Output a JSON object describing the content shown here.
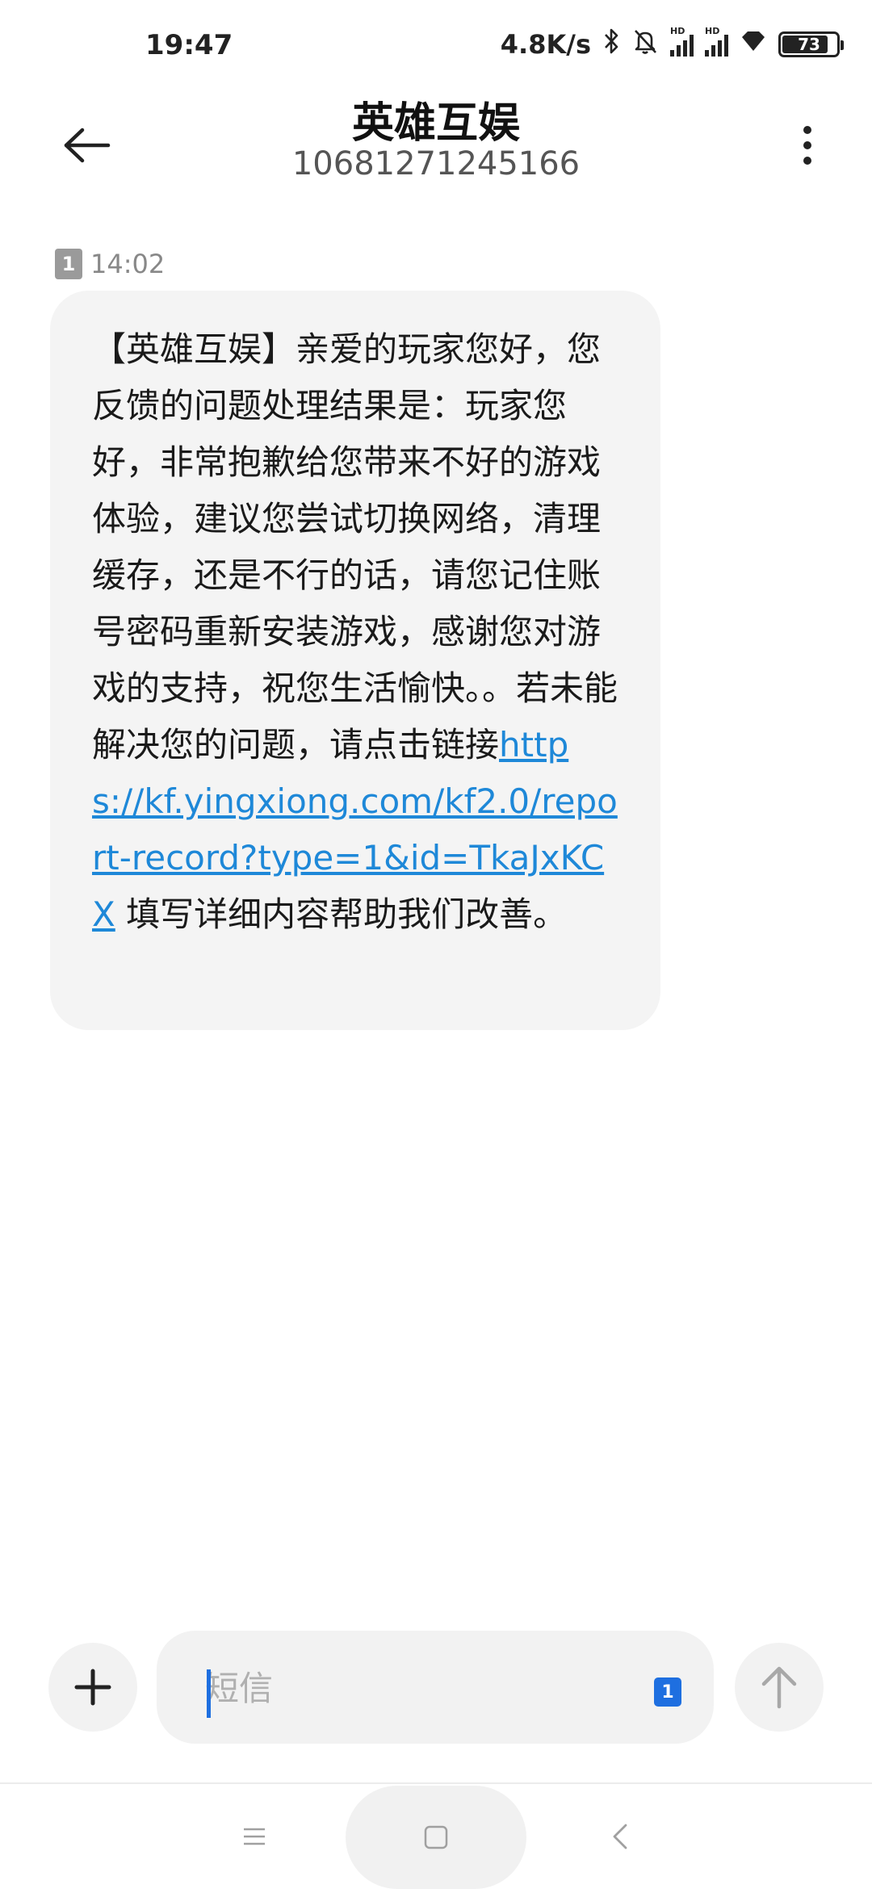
{
  "status_bar": {
    "time": "19:47",
    "net_speed": "4.8K/s",
    "sim1_tag": "HD",
    "sim2_tag": "HD",
    "battery": "73",
    "icons": [
      "bluetooth-icon",
      "mute-bell-icon",
      "signal-icon",
      "signal-icon",
      "diamond-icon",
      "battery-icon"
    ]
  },
  "header": {
    "contact_name": "英雄互娱",
    "contact_number": "10681271245166"
  },
  "message": {
    "sim_slot": "1",
    "time": "14:02",
    "text_before_link": "【英雄互娱】亲爱的玩家您好，您反馈的问题处理结果是：玩家您好，非常抱歉给您带来不好的游戏体验，建议您尝试切换网络，清理缓存，还是不行的话，请您记住账号密码重新安装游戏，感谢您对游戏的支持，祝您生活愉快。。若未能解决您的问题，请点击链接",
    "link": "https://kf.yingxiong.com/kf2.0/report-record?type=1&id=TkaJxKCX",
    "text_after_link": " 填写详细内容帮助我们改善。",
    "link_color": "#1e88d8"
  },
  "composer": {
    "placeholder": "短信",
    "value": "",
    "sim_slot": "1",
    "accent_color": "#1e6fe0"
  }
}
